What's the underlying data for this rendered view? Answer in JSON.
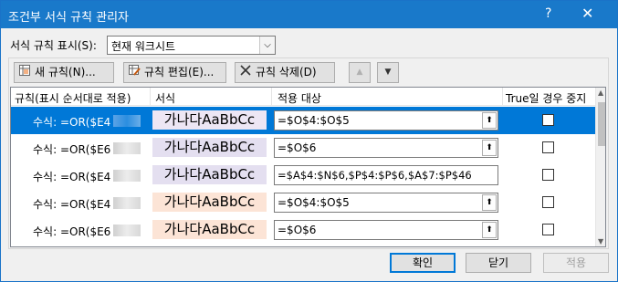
{
  "window": {
    "title": "조건부 서식 규칙 관리자",
    "help": "?",
    "close": "✕"
  },
  "show_rules": {
    "label": "서식 규칙 표시(S):",
    "value": "현재 워크시트",
    "arrow": "⌵"
  },
  "toolbar": {
    "new_label": "새 규칙(N)...",
    "edit_label": "규칙 편집(E)...",
    "delete_label": "규칙 삭제(D)",
    "up_glyph": "▲",
    "down_glyph": "▼"
  },
  "columns": {
    "rule": "규칙(표시 순서대로 적용)",
    "format": "서식",
    "applies_to": "적용 대상",
    "stop_if_true": "True일 경우 중지"
  },
  "rows": [
    {
      "rule": "수식: =OR($E4",
      "preview": "가나다AaBbCc",
      "applies_to": "=$O$4:$O$5",
      "style": "sel",
      "selected": true
    },
    {
      "rule": "수식: =OR($E6",
      "preview": "가나다AaBbCc",
      "applies_to": "=$O$6",
      "style": "purple",
      "selected": false
    },
    {
      "rule": "수식: =OR($E4",
      "preview": "가나다AaBbCc",
      "applies_to": "=$A$4:$N$6,$P$4:$P$6,$A$7:$P$46",
      "style": "purple",
      "selected": false
    },
    {
      "rule": "수식: =OR($E4",
      "preview": "가나다AaBbCc",
      "applies_to": "=$O$4:$O$5",
      "style": "orange",
      "selected": false
    },
    {
      "rule": "수식: =OR($E6",
      "preview": "가나다AaBbCc",
      "applies_to": "=$O$6",
      "style": "orange",
      "selected": false
    }
  ],
  "collapse_glyph": "⬆",
  "buttons": {
    "ok": "확인",
    "close": "닫기",
    "apply": "적용"
  },
  "colors": {
    "titlebar": "#1979ca",
    "selection": "#0078d7",
    "purple_fill": "#e4dff0",
    "orange_fill": "#fce4d6"
  }
}
